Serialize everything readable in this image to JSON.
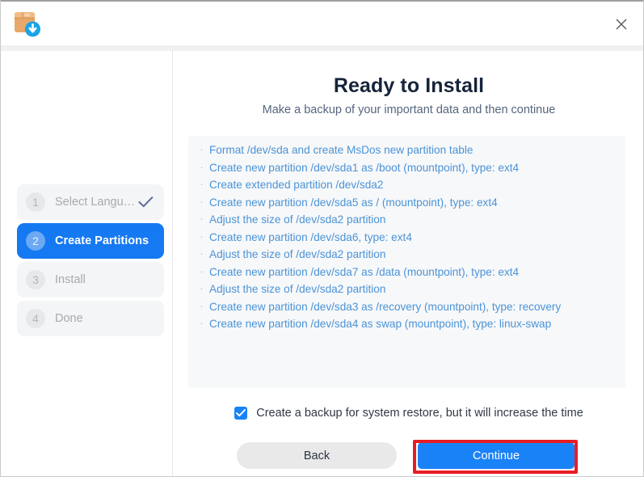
{
  "window": {
    "app_icon": "package-download-icon",
    "close_label": "close-icon"
  },
  "sidebar": {
    "items": [
      {
        "num": "1",
        "label": "Select Langu…",
        "state": "completed",
        "check": "check-icon"
      },
      {
        "num": "2",
        "label": "Create Partitions",
        "state": "active"
      },
      {
        "num": "3",
        "label": "Install",
        "state": "pending"
      },
      {
        "num": "4",
        "label": "Done",
        "state": "pending"
      }
    ]
  },
  "main": {
    "title": "Ready to Install",
    "subtitle": "Make a backup of your important data and then continue",
    "operations": [
      "Format /dev/sda and create MsDos new partition table",
      "Create new partition /dev/sda1 as /boot (mountpoint), type: ext4",
      "Create extended partition /dev/sda2",
      "Create new partition /dev/sda5 as / (mountpoint), type: ext4",
      "Adjust the size of /dev/sda2 partition",
      "Create new partition /dev/sda6, type: ext4",
      "Adjust the size of /dev/sda2 partition",
      "Create new partition /dev/sda7 as /data (mountpoint), type: ext4",
      "Adjust the size of /dev/sda2 partition",
      "Create new partition /dev/sda3 as /recovery (mountpoint), type: recovery",
      "Create new partition /dev/sda4 as swap (mountpoint), type: linux-swap"
    ],
    "bullet": "·",
    "backup_checkbox": {
      "label": "Create a backup for system restore, but it will increase the time",
      "checked": true
    },
    "buttons": {
      "back": "Back",
      "continue": "Continue"
    }
  },
  "colors": {
    "accent_blue": "#1a82f7",
    "active_step_blue": "#1579f2",
    "operation_text": "#4a93d8",
    "highlight_red": "#e81d23",
    "title_dark": "#16243a",
    "panel_bg": "#f7f8f9"
  }
}
